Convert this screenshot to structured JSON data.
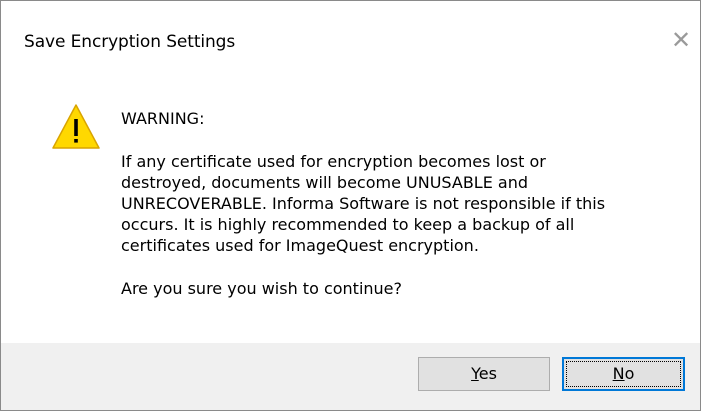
{
  "dialog": {
    "title": "Save Encryption Settings",
    "close_symbol": "✕",
    "icon": "warning-icon",
    "heading": "WARNING:",
    "message": "If any certificate used for encryption becomes lost or\ndestroyed, documents will become UNUSABLE and\nUNRECOVERABLE. Informa Software is not responsible if this\noccurs. It is highly recommended to keep a backup of all\ncertificates used for ImageQuest encryption.",
    "question": "Are you sure you wish to continue?"
  },
  "buttons": {
    "yes_accel": "Y",
    "yes_rest": "es",
    "no_accel": "N",
    "no_rest": "o"
  },
  "colors": {
    "warning_fill": "#ffd800",
    "warning_stroke": "#e0a800",
    "focus_border": "#0078d7",
    "footer_bg": "#f0f0f0",
    "button_bg": "#e1e1e1"
  }
}
